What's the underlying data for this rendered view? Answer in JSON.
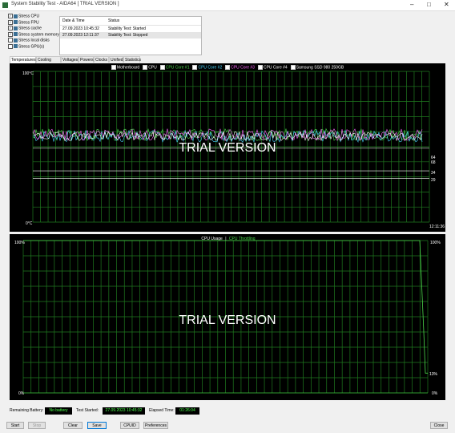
{
  "window": {
    "title": "System Stability Test - AIDA64  [ TRIAL VERSION ]",
    "minimize": "–",
    "maximize": "□",
    "close": "✕"
  },
  "stress": [
    {
      "label": "Stress CPU",
      "checked": true,
      "icon": "cpu-icon"
    },
    {
      "label": "Stress FPU",
      "checked": true,
      "icon": "fpu-icon"
    },
    {
      "label": "Stress cache",
      "checked": true,
      "icon": "cache-icon"
    },
    {
      "label": "Stress system memory",
      "checked": true,
      "icon": "memory-icon"
    },
    {
      "label": "Stress local disks",
      "checked": false,
      "icon": "disk-icon"
    },
    {
      "label": "Stress GPU(s)",
      "checked": false,
      "icon": "gpu-icon"
    }
  ],
  "status": {
    "header": {
      "date": "Date & Time",
      "status": "Status"
    },
    "rows": [
      {
        "date": "27.09.2023 10:45:32",
        "status": "Stability Test: Started"
      },
      {
        "date": "27.09.2023 12:11:37",
        "status": "Stability Test: Stopped"
      }
    ]
  },
  "tabs": [
    "Temperatures",
    "Cooling Fans",
    "Voltages",
    "Powers",
    "Clocks",
    "Unified",
    "Statistics"
  ],
  "temp_chart": {
    "legend": [
      {
        "label": "Motherboard",
        "color": "#ffffff"
      },
      {
        "label": "CPU",
        "color": "#ffffff"
      },
      {
        "label": "CPU Core #1",
        "color": "#4cd94c"
      },
      {
        "label": "CPU Core #2",
        "color": "#4ad7ff"
      },
      {
        "label": "CPU Core #3",
        "color": "#ff66ff"
      },
      {
        "label": "CPU Core #4",
        "color": "#ffffff"
      },
      {
        "label": "Samsung SSD 980 250GB",
        "color": "#ffffff"
      }
    ],
    "y_top": "100°C",
    "y_bottom": "0°C",
    "time": "12:11:36",
    "right_values": [
      "64",
      "68",
      "34",
      "29"
    ],
    "watermark": "TRIAL VERSION"
  },
  "cpu_chart": {
    "legend_left": "CPU Usage",
    "legend_sep": "|",
    "legend_right": "CPU Throttling",
    "legend_right_color": "#4cd94c",
    "y_top": "100%",
    "y_bottom": "0%",
    "y_top_right": "100%",
    "y_bottom_right": "0%",
    "right_value": "13%",
    "watermark": "TRIAL VERSION"
  },
  "footer": {
    "remaining_battery_label": "Remaining Battery:",
    "remaining_battery": "No battery",
    "test_started_label": "Test Started:",
    "test_started": "27.09.2023 10:45:32",
    "elapsed_label": "Elapsed Time:",
    "elapsed": "01:26:04"
  },
  "buttons": {
    "start": "Start",
    "stop": "Stop",
    "clear": "Clear",
    "save": "Save",
    "cpuid": "CPUID",
    "preferences": "Preferences",
    "close": "Close"
  }
}
